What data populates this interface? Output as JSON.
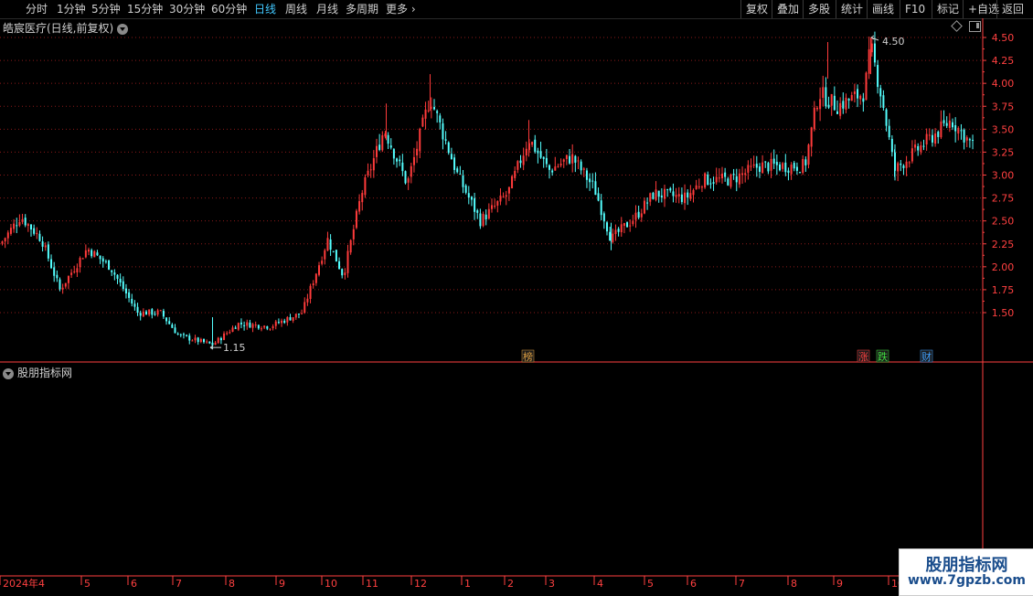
{
  "toolbar": {
    "periods": [
      "分时",
      "1分钟",
      "5分钟",
      "15分钟",
      "30分钟",
      "60分钟",
      "日线",
      "周线",
      "月线",
      "多周期",
      "更多"
    ],
    "active_period": "日线",
    "right_buttons": [
      "复权",
      "叠加",
      "多股",
      "统计",
      "画线",
      "F10",
      "标记",
      "+自选",
      "返回"
    ]
  },
  "chart": {
    "title": "皓宸医疗(日线,前复权)",
    "high_label": "4.50",
    "low_label": "1.15",
    "markers": [
      {
        "text": "榜",
        "color": "#e0a040"
      },
      {
        "text": "涨",
        "color": "#ff4040"
      },
      {
        "text": "跌",
        "color": "#40e040"
      },
      {
        "text": "财",
        "color": "#40a0ff"
      }
    ]
  },
  "indicator": {
    "title": "股朋指标网"
  },
  "watermark": {
    "line1": "股朋指标网",
    "line2": "www.7gpzb.com"
  },
  "colors": {
    "up": "#ff3b3b",
    "down": "#54ffff",
    "grid": "#8b1a1a",
    "axis": "#ff4040"
  },
  "chart_data": {
    "type": "candlestick",
    "ylim": [
      1.15,
      4.5
    ],
    "y_ticks": [
      1.5,
      1.75,
      2.0,
      2.25,
      2.5,
      2.75,
      3.0,
      3.25,
      3.5,
      3.75,
      4.0,
      4.25,
      4.5
    ],
    "y_tick_labels": [
      "1.50",
      "1.75",
      "2.00",
      "2.25",
      "2.50",
      "2.75",
      "3.00",
      "3.25",
      "3.50",
      "3.75",
      "4.00",
      "4.25",
      "4.50"
    ],
    "x_labels": [
      "2024年4",
      "5",
      "6",
      "7",
      "8",
      "9",
      "10",
      "11",
      "12",
      "1",
      "2",
      "3",
      "4",
      "5",
      "6",
      "7",
      "8",
      "9",
      "10"
    ],
    "price_path": [
      [
        0,
        2.25
      ],
      [
        22,
        2.55
      ],
      [
        45,
        2.3
      ],
      [
        65,
        1.75
      ],
      [
        95,
        2.2
      ],
      [
        120,
        2.0
      ],
      [
        150,
        1.5
      ],
      [
        175,
        1.5
      ],
      [
        195,
        1.25
      ],
      [
        232,
        1.15
      ],
      [
        260,
        1.38
      ],
      [
        295,
        1.35
      ],
      [
        330,
        1.5
      ],
      [
        358,
        2.3
      ],
      [
        375,
        1.9
      ],
      [
        395,
        2.8
      ],
      [
        420,
        3.5
      ],
      [
        445,
        2.9
      ],
      [
        470,
        3.85
      ],
      [
        500,
        3.0
      ],
      [
        525,
        2.5
      ],
      [
        555,
        2.8
      ],
      [
        578,
        3.4
      ],
      [
        600,
        3.05
      ],
      [
        625,
        3.2
      ],
      [
        650,
        2.85
      ],
      [
        668,
        2.3
      ],
      [
        695,
        2.55
      ],
      [
        715,
        2.8
      ],
      [
        750,
        2.75
      ],
      [
        768,
        2.95
      ],
      [
        800,
        2.95
      ],
      [
        830,
        3.1
      ],
      [
        880,
        3.1
      ],
      [
        895,
        3.9
      ],
      [
        915,
        3.75
      ],
      [
        945,
        3.9
      ],
      [
        952,
        4.4
      ],
      [
        965,
        3.8
      ],
      [
        978,
        3.05
      ],
      [
        1000,
        3.25
      ],
      [
        1040,
        3.6
      ],
      [
        1065,
        3.3
      ]
    ]
  }
}
